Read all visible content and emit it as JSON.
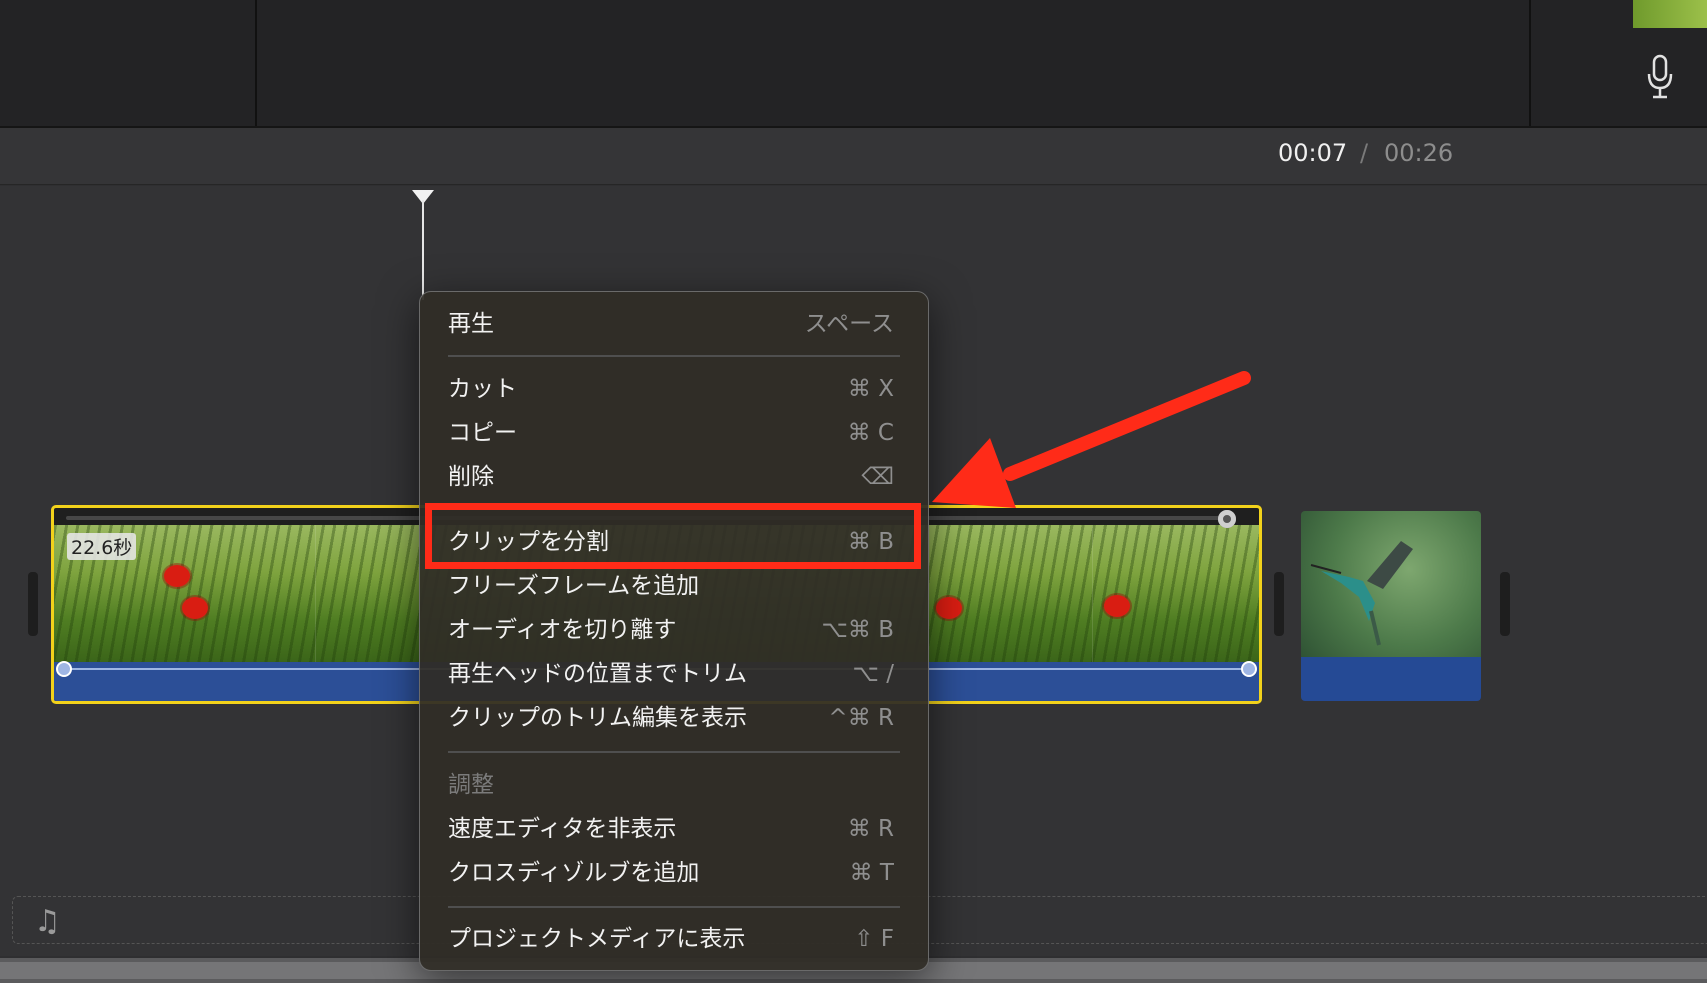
{
  "timecode": {
    "current": "00:07",
    "separator": "/",
    "total": "00:26"
  },
  "main_clip": {
    "duration_label": "22.6秒"
  },
  "context_menu": {
    "items": [
      {
        "label": "再生",
        "shortcut": "スペース"
      },
      {
        "label": "カット",
        "shortcut": "⌘ X"
      },
      {
        "label": "コピー",
        "shortcut": "⌘ C"
      },
      {
        "label": "削除",
        "shortcut": "⌫"
      },
      {
        "label": "クリップを分割",
        "shortcut": "⌘ B"
      },
      {
        "label": "フリーズフレームを追加",
        "shortcut": ""
      },
      {
        "label": "オーディオを切り離す",
        "shortcut": "⌥⌘ B"
      },
      {
        "label": "再生ヘッドの位置までトリム",
        "shortcut": "⌥ /"
      },
      {
        "label": "クリップのトリム編集を表示",
        "shortcut": "^⌘ R"
      },
      {
        "label": "調整",
        "shortcut": ""
      },
      {
        "label": "速度エディタを非表示",
        "shortcut": "⌘ R"
      },
      {
        "label": "クロスディゾルブを追加",
        "shortcut": "⌘ T"
      },
      {
        "label": "プロジェクトメディアに表示",
        "shortcut": "⇧ F"
      }
    ]
  },
  "icons": {
    "microphone": "microphone-icon",
    "music": "music-note-icon"
  },
  "colors": {
    "highlight": "#ff2b18",
    "clip_border": "#f2d21b",
    "audio": "#2c4f97"
  }
}
